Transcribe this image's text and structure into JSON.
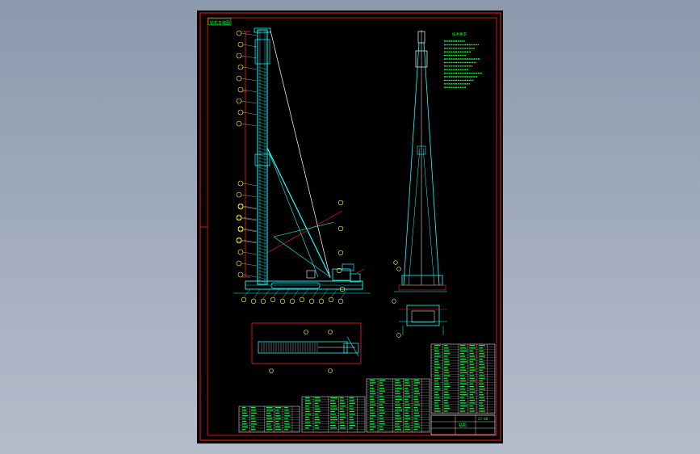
{
  "viewer": {
    "background_color": "#9aa5b8"
  },
  "sheet": {
    "background_color": "#000000",
    "frame_color": "#ff2020",
    "structure_color": "#19ffff",
    "text_color": "#00ff3a",
    "mast_color": "#ffffff",
    "label_color": "#ffff40"
  },
  "title_tag": {
    "text": "钻机总装图"
  },
  "balloon_count_left": 22,
  "balloon_count_bottom": 11,
  "tech_notes": {
    "heading": "技术要求",
    "line_count": 14
  },
  "parts_table": {
    "columns": 7,
    "rows": 25
  },
  "title_block": {
    "title": "钻机",
    "drawing_no": "ZJ-00"
  },
  "icons": [
    "crawler-track-icon",
    "winch-drum-icon",
    "mast-pulley-icon"
  ]
}
